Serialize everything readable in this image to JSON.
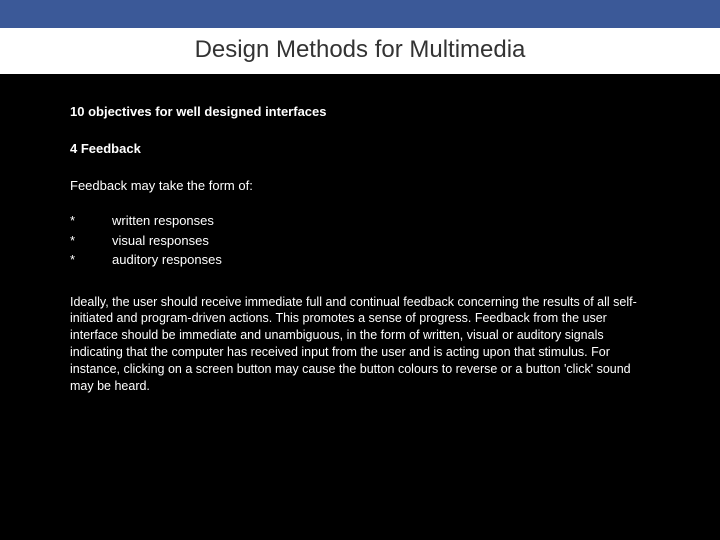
{
  "slide": {
    "title": "Design Methods for Multimedia",
    "section_heading": "10 objectives for well designed interfaces",
    "sub_heading": "4 Feedback",
    "intro": "Feedback may take the form of:",
    "bullets": [
      {
        "marker": "*",
        "text": "written responses"
      },
      {
        "marker": "*",
        "text": "visual responses"
      },
      {
        "marker": "*",
        "text": "auditory responses"
      }
    ],
    "paragraph": "Ideally, the user should receive immediate full and continual feedback concerning the results of all self-initiated and program-driven actions. This promotes a sense of progress. Feedback from the user interface should be immediate and unambiguous, in the form of written, visual or auditory signals indicating that the computer has received input from the user and is acting upon that stimulus. For instance, clicking on a screen button may cause the button colours to reverse or a button 'click' sound may be heard."
  }
}
